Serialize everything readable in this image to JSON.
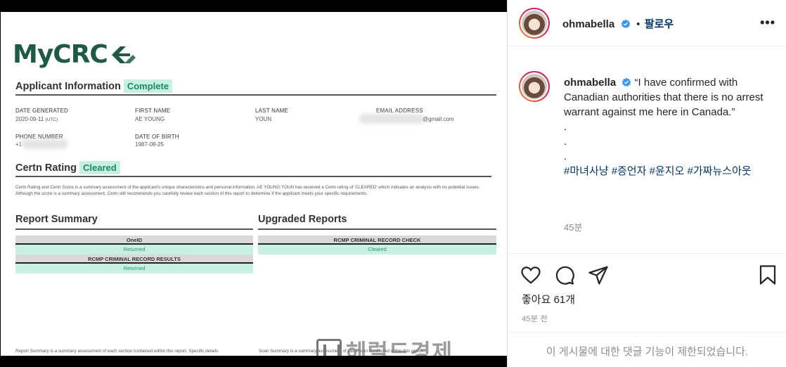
{
  "document": {
    "logo_text": "MyCRC",
    "applicant_section": {
      "title": "Applicant Information",
      "status": "Complete"
    },
    "fields": {
      "date_generated_label": "DATE GENERATED",
      "date_generated_value": "2020-09-11",
      "date_generated_suffix": "(UTC)",
      "first_name_label": "FIRST NAME",
      "first_name_value": "AE YOUNG",
      "last_name_label": "LAST NAME",
      "last_name_value": "YOUN",
      "email_label": "EMAIL ADDRESS",
      "email_value": "@gmail.com",
      "phone_label": "PHONE NUMBER",
      "phone_value": "+1",
      "dob_label": "DATE OF BIRTH",
      "dob_value": "1987-08-25"
    },
    "rating_section": {
      "title": "Certn Rating",
      "status": "Cleared"
    },
    "rating_paragraph": "Certn Rating and Certn Score is a summary assessment of the applicant's unique characteristics and personal information. AE YOUNG YOUN has received a Certn rating of 'CLEARED' which indicates an analysis with no potential issues. Although the score is a summary assessment, Certn still recommends you carefully review each section of this report to determine if the applicant meets your specific requirements.",
    "report_summary": {
      "title": "Report Summary",
      "rows": [
        {
          "label": "OneID",
          "status": "Returned"
        },
        {
          "label": "RCMP CRIMINAL RECORD RESULTS",
          "status": "Returned"
        }
      ]
    },
    "upgraded_reports": {
      "title": "Upgraded Reports",
      "rows": [
        {
          "label": "RCMP CRIMINAL RECORD CHECK",
          "status": "Cleared"
        }
      ]
    },
    "footer_left": "Report Summary is a summary assessment of each section contained within this report. Specific details",
    "footer_right": "Scan Summary is a summary assessment of each scan conducted within this report.",
    "watermark": "헤럴드경제"
  },
  "post": {
    "username": "ohmabella",
    "follow_separator": "•",
    "follow_label": "팔로우",
    "more_icon": "more-icon",
    "caption_username": "ohmabella",
    "caption_text": "“I have confirmed with Canadian authorities that there is no arrest warrant against me here in Canada.”",
    "caption_dots": [
      ".",
      ".",
      "."
    ],
    "hashtags": "#마녀사냥 #증언자 #윤지오 #가짜뉴스아웃",
    "caption_time": "45분",
    "likes": "좋아요 61개",
    "posted_time": "45분 전",
    "comments_disabled": "이 게시물에 대한 댓글 기능이 제한되었습니다.",
    "brand_color": "#0095f6",
    "link_color": "#00376b"
  }
}
